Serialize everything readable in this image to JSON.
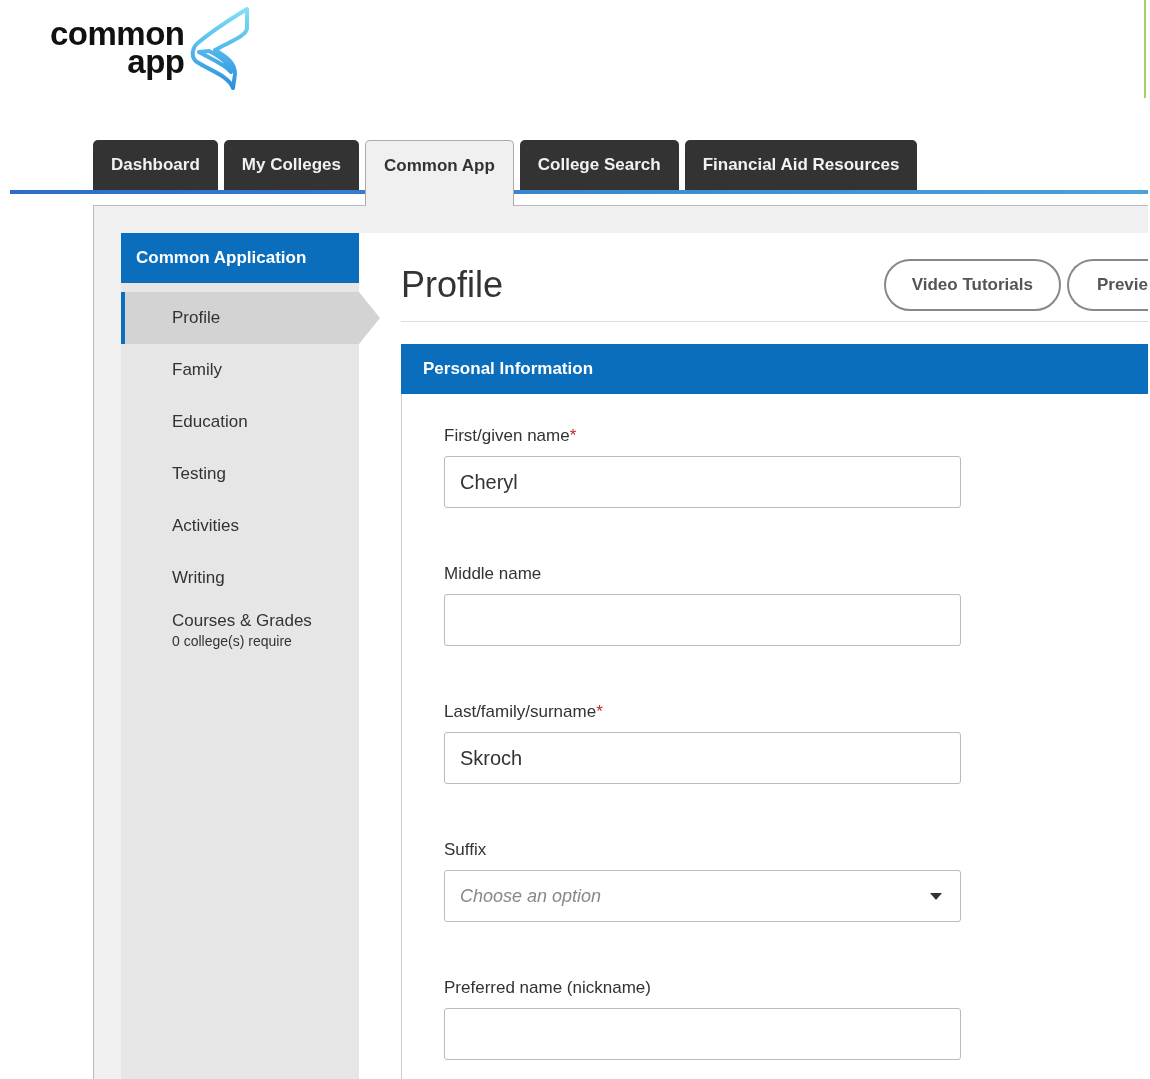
{
  "logo": {
    "line_1": "common",
    "line_2": "app"
  },
  "tabs": [
    {
      "label": "Dashboard",
      "selected": false
    },
    {
      "label": "My Colleges",
      "selected": false
    },
    {
      "label": "Common App",
      "selected": true
    },
    {
      "label": "College Search",
      "selected": false
    },
    {
      "label": "Financial Aid Resources",
      "selected": false
    }
  ],
  "sidebar": {
    "title": "Common Application",
    "items": [
      {
        "label": "Profile",
        "selected": true
      },
      {
        "label": "Family",
        "selected": false
      },
      {
        "label": "Education",
        "selected": false
      },
      {
        "label": "Testing",
        "selected": false
      },
      {
        "label": "Activities",
        "selected": false
      },
      {
        "label": "Writing",
        "selected": false
      },
      {
        "label": "Courses & Grades",
        "note": "0 college(s) require",
        "selected": false
      }
    ]
  },
  "page": {
    "title": "Profile",
    "buttons": [
      "Video Tutorials",
      "Previe"
    ]
  },
  "section": {
    "title": "Personal Information",
    "fields": [
      {
        "kind": "text",
        "label": "First/given name",
        "required_mark": "*",
        "value": "Cheryl"
      },
      {
        "kind": "text",
        "label": "Middle name"
      },
      {
        "kind": "text",
        "label": "Last/family/surname",
        "required_mark": "*",
        "value": "Skroch"
      },
      {
        "kind": "select",
        "label": "Suffix",
        "placeholder": "Choose an option"
      },
      {
        "kind": "text",
        "label": "Preferred name (nickname)"
      }
    ]
  }
}
